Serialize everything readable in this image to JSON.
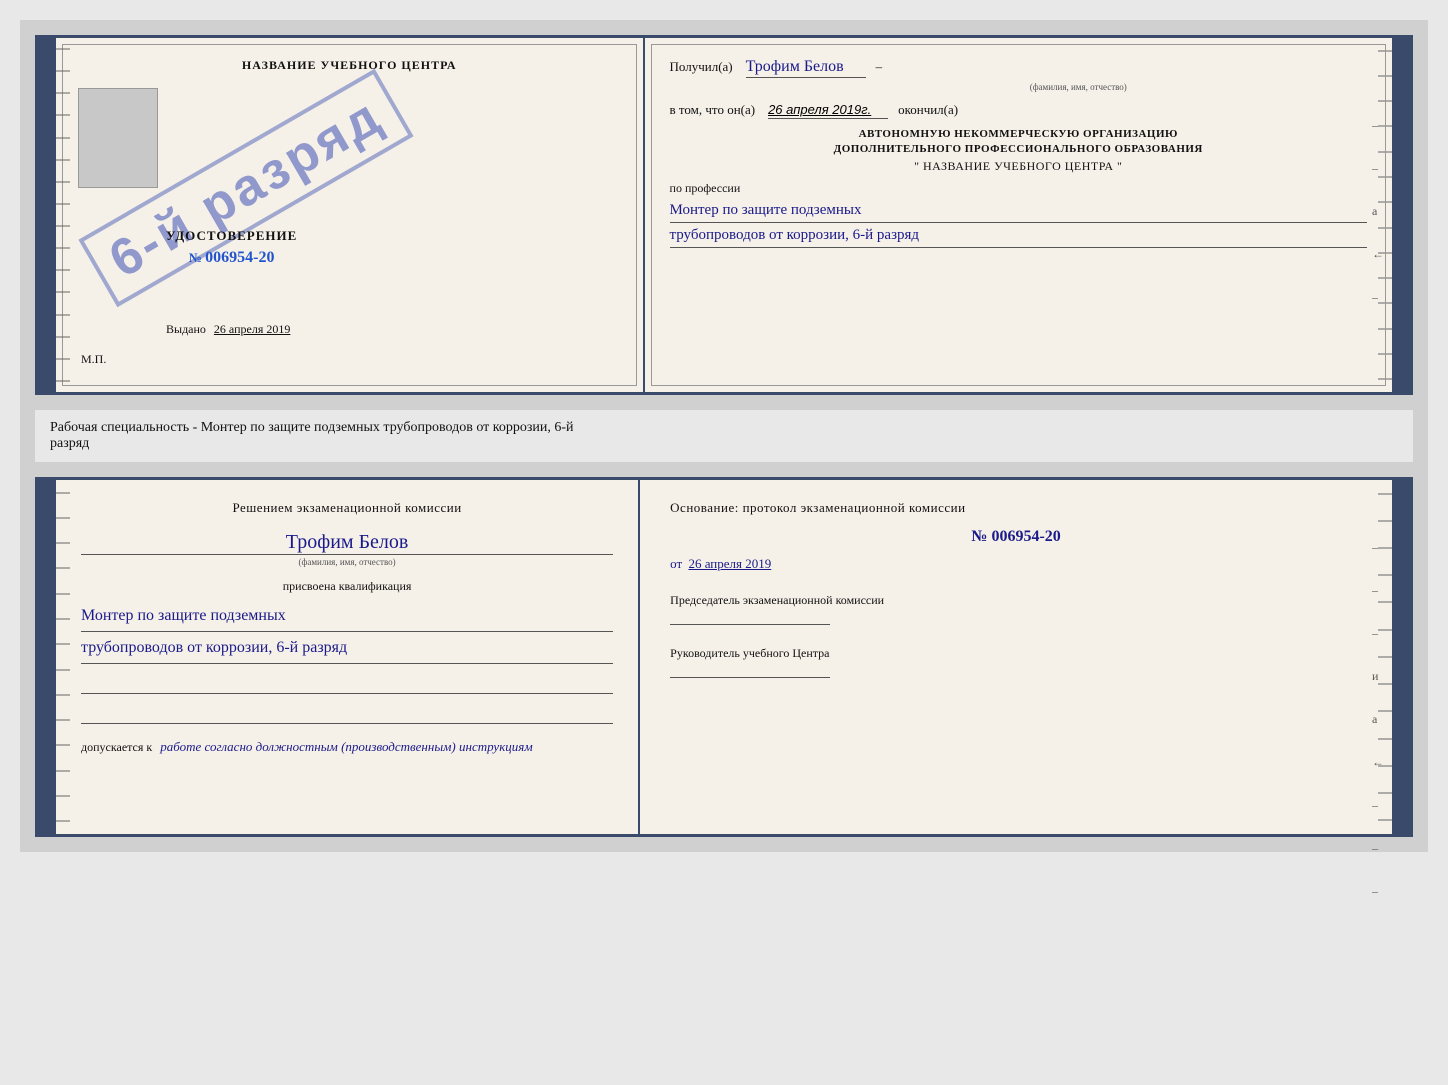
{
  "page": {
    "background": "#d0d0d0"
  },
  "certificate": {
    "left": {
      "title": "НАЗВАНИЕ УЧЕБНОГО ЦЕНТРА",
      "udostoverenie_label": "УДОСТОВЕРЕНИЕ",
      "number_prefix": "№",
      "number": "006954-20",
      "stamp_text": "6-й разряд",
      "issued_label": "Выдано",
      "issued_date": "26 апреля 2019",
      "mp_label": "М.П."
    },
    "right": {
      "received_label": "Получил(а)",
      "name_value": "Трофим Белов",
      "name_subtext": "(фамилия, имя, отчество)",
      "dash1": "–",
      "in_that_label": "в том, что он(а)",
      "date_value": "26 апреля 2019г.",
      "finished_label": "окончил(а)",
      "org_line1": "АВТОНОМНУЮ НЕКОММЕРЧЕСКУЮ ОРГАНИЗАЦИЮ",
      "org_line2": "ДОПОЛНИТЕЛЬНОГО ПРОФЕССИОНАЛЬНОГО ОБРАЗОВАНИЯ",
      "org_line3": "\"    НАЗВАНИЕ УЧЕБНОГО ЦЕНТРА    \"",
      "dash2": "–",
      "profession_label": "по профессии",
      "profession_line1": "Монтер по защите подземных",
      "profession_line2": "трубопроводов от коррозии, 6-й разряд",
      "side_dashes": [
        "–",
        "–",
        "а",
        "←",
        "–"
      ]
    }
  },
  "middle_text": {
    "line1": "Рабочая специальность - Монтер по защите подземных трубопроводов от коррозии, 6-й",
    "line2": "разряд"
  },
  "qualification": {
    "left": {
      "section_title": "Решением экзаменационной комиссии",
      "name_value": "Трофим Белов",
      "name_subtext": "(фамилия, имя, отчество)",
      "assigned_label": "присвоена квалификация",
      "profession_line1": "Монтер по защите подземных",
      "profession_line2": "трубопроводов от коррозии, 6-й разряд",
      "allowed_label": "допускается к",
      "allowed_value": "работе согласно должностным (производственным) инструкциям"
    },
    "right": {
      "basis_label": "Основание: протокол экзаменационной комиссии",
      "protocol_number": "№  006954-20",
      "date_prefix": "от",
      "date_value": "26 апреля 2019",
      "chairman_label": "Председатель экзаменационной комиссии",
      "director_label": "Руководитель учебного Центра",
      "side_dashes": [
        "–",
        "–",
        "–",
        "и",
        "а",
        "←",
        "–",
        "–",
        "–",
        "–",
        "–"
      ]
    }
  }
}
